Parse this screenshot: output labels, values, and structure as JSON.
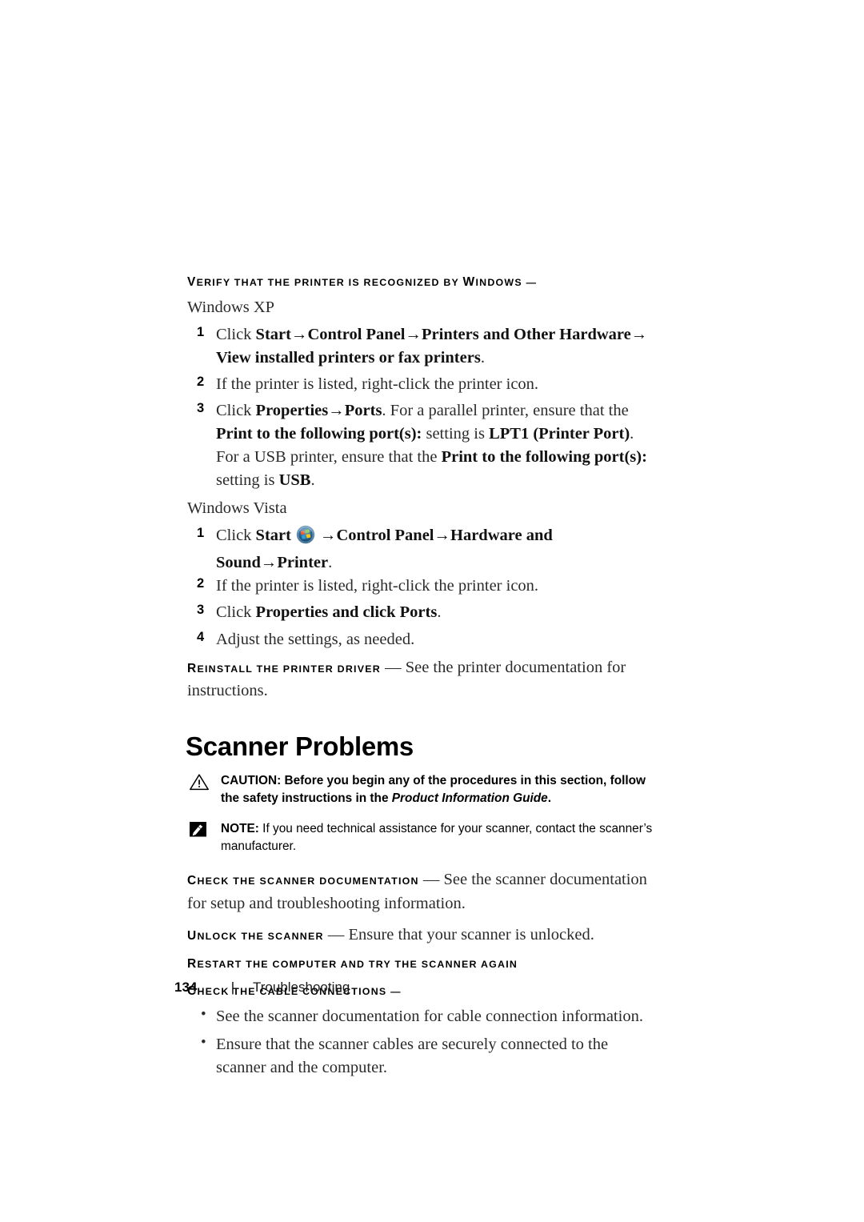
{
  "document": {
    "page_number": "134",
    "footer_separator": "|",
    "chapter": "Troubleshooting"
  },
  "printer_section": {
    "verify_heading_cap": "V",
    "verify_heading_rest": "ERIFY THAT THE PRINTER IS RECOGNIZED BY ",
    "verify_heading_win_cap": "W",
    "verify_heading_win_rest": "INDOWS",
    "verify_heading_dash": " —",
    "winxp_label": "Windows XP",
    "winxp_steps": [
      {
        "num": "1",
        "parts": [
          {
            "text": "Click ",
            "bold": false
          },
          {
            "text": "Start→Control Panel→Printers and Other Hardware→ View installed printers or fax printers",
            "bold": true
          },
          {
            "text": ".",
            "bold": false
          }
        ]
      },
      {
        "num": "2",
        "parts": [
          {
            "text": "If the printer is listed, right-click the printer icon.",
            "bold": false
          }
        ]
      },
      {
        "num": "3",
        "parts": [
          {
            "text": "Click ",
            "bold": false
          },
          {
            "text": "Properties→Ports",
            "bold": true
          },
          {
            "text": ". For a parallel printer, ensure that the ",
            "bold": false
          },
          {
            "text": "Print to the following port(s):",
            "bold": true
          },
          {
            "text": " setting is ",
            "bold": false
          },
          {
            "text": "LPT1 (Printer Port)",
            "bold": true
          },
          {
            "text": ". For a USB printer, ensure that the ",
            "bold": false
          },
          {
            "text": "Print to the following port(s):",
            "bold": true
          },
          {
            "text": " setting is ",
            "bold": false
          },
          {
            "text": "USB",
            "bold": true
          },
          {
            "text": ".",
            "bold": false
          }
        ]
      }
    ],
    "winvista_label": "Windows Vista",
    "vista_step1_pre": "Click ",
    "vista_step1_start": "Start",
    "vista_step1_post": "→Control Panel→Hardware and Sound→Printer",
    "vista_step1_end": ".",
    "vista_step1_num": "1",
    "winvista_steps": [
      {
        "num": "2",
        "parts": [
          {
            "text": "If the printer is listed, right-click the printer icon.",
            "bold": false
          }
        ]
      },
      {
        "num": "3",
        "parts": [
          {
            "text": "Click ",
            "bold": false
          },
          {
            "text": "Properties and click Ports",
            "bold": true
          },
          {
            "text": ".",
            "bold": false
          }
        ]
      },
      {
        "num": "4",
        "parts": [
          {
            "text": "Adjust the settings, as needed.",
            "bold": false
          }
        ]
      }
    ],
    "reinstall_cap": "R",
    "reinstall_rest": "EINSTALL THE PRINTER DRIVER",
    "reinstall_body": " — See the printer documentation for instructions."
  },
  "scanner_section": {
    "title": "Scanner Problems",
    "caution": {
      "icon": "warning-triangle-icon",
      "lead": "CAUTION:",
      "text_before": " Before you begin any of the procedures in this section, follow the safety instructions in the ",
      "italic_title": "Product Information Guide",
      "text_after": "."
    },
    "note": {
      "icon": "note-pencil-icon",
      "lead": "NOTE:",
      "text": " If you need technical assistance for your scanner, contact the scanner’s manufacturer."
    },
    "tips": [
      {
        "cap": "C",
        "heading_rest": "HECK THE SCANNER DOCUMENTATION",
        "body": " — See the scanner documentation for setup and troubleshooting information."
      },
      {
        "cap": "U",
        "heading_rest": "NLOCK THE SCANNER",
        "body": " — Ensure that your scanner is unlocked."
      }
    ],
    "restart_cap": "R",
    "restart_rest": "ESTART THE COMPUTER AND TRY THE SCANNER AGAIN",
    "cables_cap": "C",
    "cables_rest": "HECK THE CABLE CONNECTIONS",
    "cables_dash": " —",
    "cable_bullets": [
      {
        "bullet": "•",
        "text": "See the scanner documentation for cable connection information."
      },
      {
        "bullet": "•",
        "text": "Ensure that the scanner cables are securely connected to the scanner and the computer."
      }
    ]
  },
  "colors": {
    "text": "#2b2b2b",
    "heading": "#000000",
    "vista_orb_outer": "#9fb9cc",
    "vista_orb_inner": "#2f6ea8"
  }
}
